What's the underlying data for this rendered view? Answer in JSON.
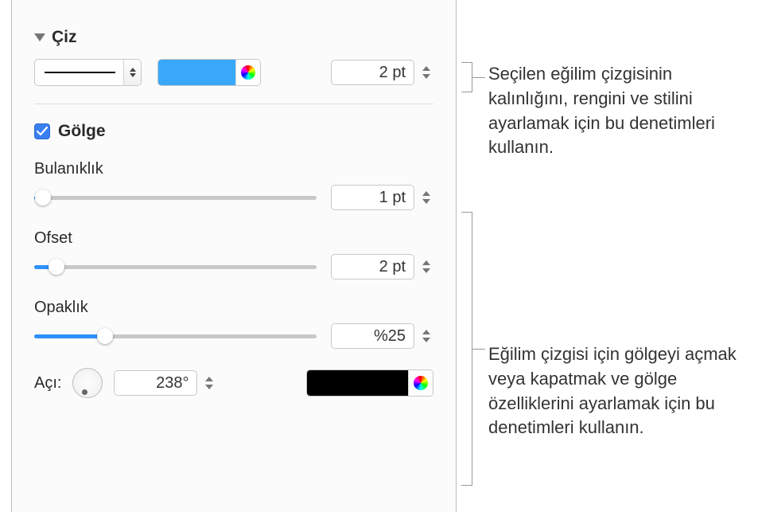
{
  "stroke": {
    "section_title": "Çiz",
    "thickness_value": "2 pt",
    "color": "#39a8fb"
  },
  "shadow": {
    "checkbox_label": "Gölge",
    "checked": true,
    "blur": {
      "label": "Bulanıklık",
      "value": "1 pt",
      "slider_percent": 3
    },
    "offset": {
      "label": "Ofset",
      "value": "2 pt",
      "slider_percent": 8
    },
    "opacity": {
      "label": "Opaklık",
      "value": "%25",
      "slider_percent": 25
    },
    "angle": {
      "label": "Açı:",
      "value": "238°"
    },
    "color": "#000000"
  },
  "annotations": {
    "stroke_hint": "Seçilen eğilim çizgisinin kalınlığını, rengini ve stilini ayarlamak için bu denetimleri kullanın.",
    "shadow_hint": "Eğilim çizgisi için gölgeyi açmak veya kapatmak ve gölge özelliklerini ayarlamak için bu denetimleri kullanın."
  }
}
